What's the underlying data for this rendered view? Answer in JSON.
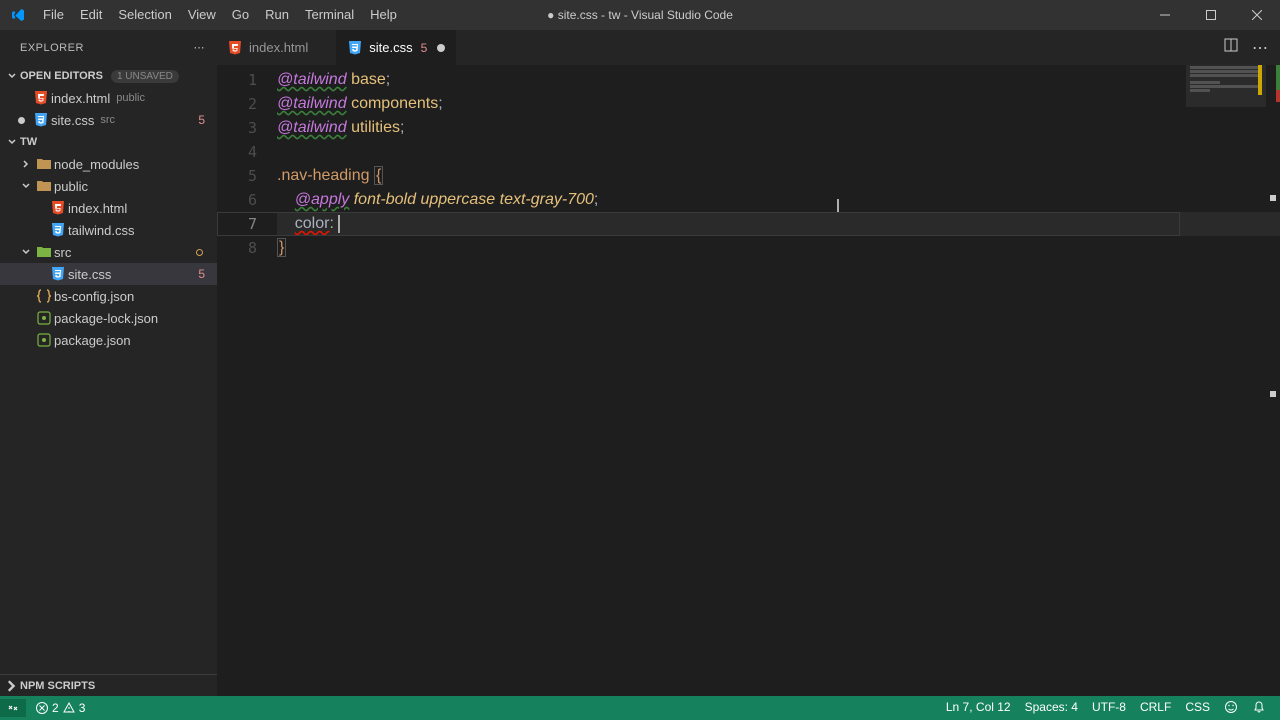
{
  "window": {
    "title": "● site.css - tw - Visual Studio Code"
  },
  "menu": [
    "File",
    "Edit",
    "Selection",
    "View",
    "Go",
    "Run",
    "Terminal",
    "Help"
  ],
  "explorer": {
    "title": "EXPLORER",
    "open_editors_label": "OPEN EDITORS",
    "unsaved_badge": "1 UNSAVED",
    "open_editors": [
      {
        "name": "index.html",
        "suffix": "public",
        "icon": "html"
      },
      {
        "name": "site.css",
        "suffix": "src",
        "icon": "css",
        "problems": "5",
        "modified": true
      }
    ],
    "root_label": "TW",
    "tree": [
      {
        "name": "node_modules",
        "icon": "folder",
        "indent": 1
      },
      {
        "name": "public",
        "icon": "folder",
        "indent": 1,
        "expanded": true
      },
      {
        "name": "index.html",
        "icon": "html",
        "indent": 2
      },
      {
        "name": "tailwind.css",
        "icon": "css",
        "indent": 2
      },
      {
        "name": "src",
        "icon": "folder-src",
        "indent": 1,
        "expanded": true,
        "git": true
      },
      {
        "name": "site.css",
        "icon": "css",
        "indent": 2,
        "selected": true,
        "problems": "5"
      },
      {
        "name": "bs-config.json",
        "icon": "json-y",
        "indent": 1
      },
      {
        "name": "package-lock.json",
        "icon": "json-g",
        "indent": 1
      },
      {
        "name": "package.json",
        "icon": "json-g",
        "indent": 1
      }
    ],
    "npm_scripts": "NPM SCRIPTS"
  },
  "tabs": [
    {
      "name": "index.html",
      "icon": "html",
      "active": false
    },
    {
      "name": "site.css",
      "icon": "css",
      "active": true,
      "problems": "5",
      "modified": true
    }
  ],
  "code": {
    "lines": [
      {
        "n": "1",
        "segs": [
          {
            "t": "@tailwind",
            "c": "tk-wave-g"
          },
          {
            "t": " ",
            "c": ""
          },
          {
            "t": "base",
            "c": "tk-id"
          },
          {
            "t": ";",
            "c": "tk-p"
          }
        ]
      },
      {
        "n": "2",
        "segs": [
          {
            "t": "@tailwind",
            "c": "tk-wave-g"
          },
          {
            "t": " ",
            "c": ""
          },
          {
            "t": "components",
            "c": "tk-id"
          },
          {
            "t": ";",
            "c": "tk-p"
          }
        ]
      },
      {
        "n": "3",
        "segs": [
          {
            "t": "@tailwind",
            "c": "tk-wave-g"
          },
          {
            "t": " ",
            "c": ""
          },
          {
            "t": "utilities",
            "c": "tk-id"
          },
          {
            "t": ";",
            "c": "tk-p"
          }
        ]
      },
      {
        "n": "4",
        "segs": []
      },
      {
        "n": "5",
        "segs": [
          {
            "t": ".nav-heading",
            "c": "tk-sel"
          },
          {
            "t": " ",
            "c": ""
          },
          {
            "t": "{",
            "c": "tk-br br-box"
          }
        ]
      },
      {
        "n": "6",
        "segs": [
          {
            "t": "    ",
            "c": ""
          },
          {
            "t": "@apply",
            "c": "tk-wave-g"
          },
          {
            "t": " ",
            "c": ""
          },
          {
            "t": "font-bold",
            "c": "tk-val"
          },
          {
            "t": " ",
            "c": ""
          },
          {
            "t": "uppercase",
            "c": "tk-val"
          },
          {
            "t": " ",
            "c": ""
          },
          {
            "t": "text-gray-700",
            "c": "tk-val"
          },
          {
            "t": ";",
            "c": "tk-p"
          }
        ]
      },
      {
        "n": "7",
        "hl": true,
        "segs": [
          {
            "t": "    ",
            "c": ""
          },
          {
            "t": "color",
            "c": "tk-prop tk-wave-r"
          },
          {
            "t": ":",
            "c": "tk-p"
          },
          {
            "t": " ",
            "c": ""
          }
        ]
      },
      {
        "n": "8",
        "segs": [
          {
            "t": "}",
            "c": "tk-br br-box"
          }
        ]
      }
    ]
  },
  "status": {
    "errors": "2",
    "warnings": "3",
    "ln_col": "Ln 7, Col 12",
    "spaces": "Spaces: 4",
    "encoding": "UTF-8",
    "eol": "CRLF",
    "lang": "CSS",
    "feedback": "☻"
  }
}
